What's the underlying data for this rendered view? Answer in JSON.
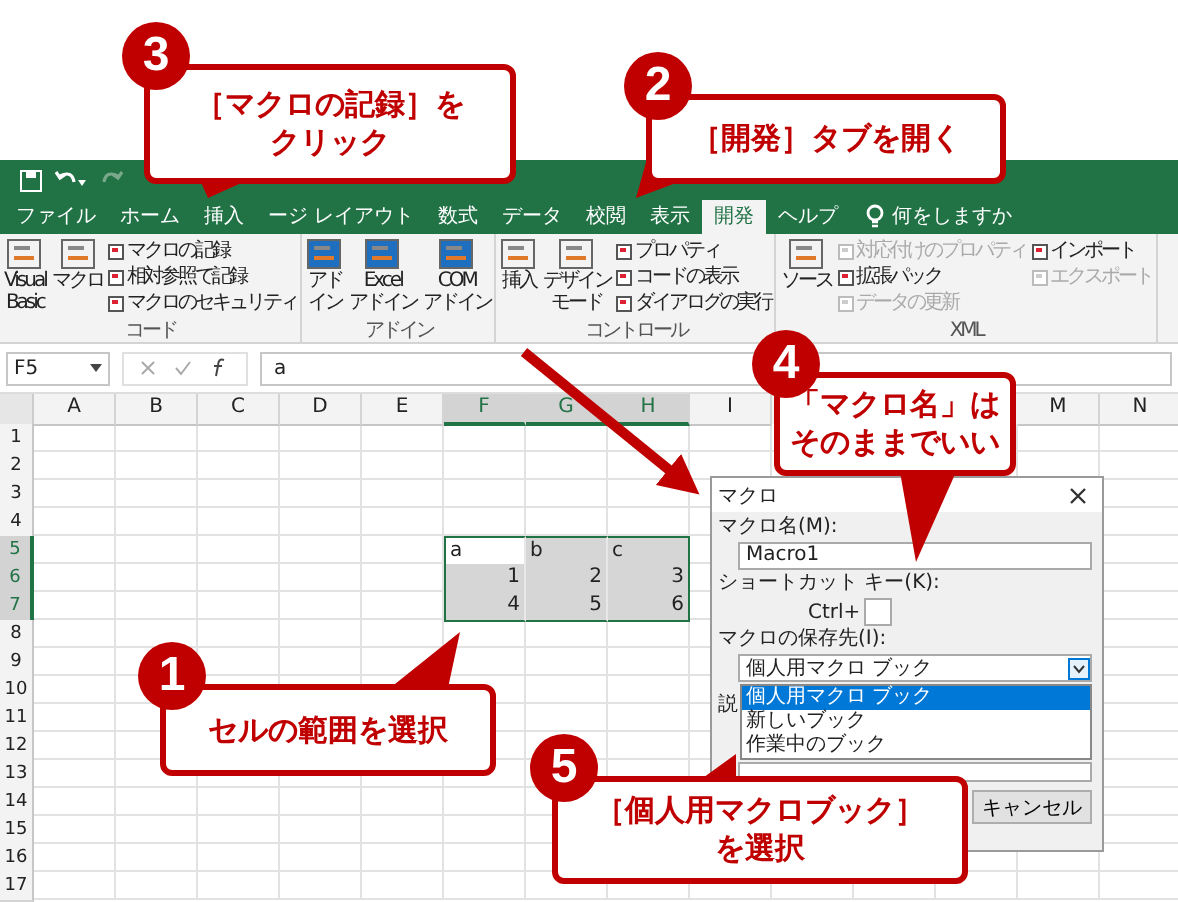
{
  "tabs": [
    {
      "label": "ファイル",
      "selected": false
    },
    {
      "label": "ホーム",
      "selected": false
    },
    {
      "label": "挿入",
      "selected": false
    },
    {
      "label": "ージ レイアウト",
      "selected": false
    },
    {
      "label": "数式",
      "selected": false
    },
    {
      "label": "データ",
      "selected": false
    },
    {
      "label": "校閲",
      "selected": false
    },
    {
      "label": "表示",
      "selected": false
    },
    {
      "label": "開発",
      "selected": true
    },
    {
      "label": "ヘルプ",
      "selected": false
    }
  ],
  "tell_me": "何をしますか",
  "ribbon": {
    "groups": [
      {
        "label": "コード",
        "buttons": [
          {
            "lines": [
              "Visual",
              "Basic"
            ],
            "kind": "large",
            "disabled": false
          },
          {
            "lines": [
              "マクロ"
            ],
            "kind": "large",
            "disabled": false
          },
          {
            "label": "マクロの記録",
            "kind": "small",
            "disabled": false
          },
          {
            "label": "相対参照で記録",
            "kind": "small",
            "disabled": false
          },
          {
            "label": "マクロのセキュリティ",
            "kind": "small",
            "disabled": false
          }
        ]
      },
      {
        "label": "アドイン",
        "buttons": [
          {
            "lines": [
              "アド",
              "イン"
            ],
            "kind": "large",
            "disabled": false
          },
          {
            "lines": [
              "Excel",
              "アドイン"
            ],
            "kind": "large",
            "disabled": false
          },
          {
            "lines": [
              "COM",
              "アドイン"
            ],
            "kind": "large",
            "disabled": false
          }
        ]
      },
      {
        "label": "コントロール",
        "buttons": [
          {
            "lines": [
              "挿入"
            ],
            "kind": "large",
            "disabled": false
          },
          {
            "lines": [
              "デザイン",
              "モード"
            ],
            "kind": "large",
            "disabled": false
          },
          {
            "label": "プロパティ",
            "kind": "small",
            "disabled": false
          },
          {
            "label": "コードの表示",
            "kind": "small",
            "disabled": false
          },
          {
            "label": "ダイアログの実行",
            "kind": "small",
            "disabled": false
          }
        ]
      },
      {
        "label": "XML",
        "buttons": [
          {
            "lines": [
              "ソース"
            ],
            "kind": "large",
            "disabled": false
          },
          {
            "label": "対応付けのプロパティ",
            "kind": "small",
            "disabled": true
          },
          {
            "label": "拡張パック",
            "kind": "small",
            "disabled": false
          },
          {
            "label": "データの更新",
            "kind": "small",
            "disabled": true
          },
          {
            "label": "インポート",
            "kind": "small",
            "disabled": false
          },
          {
            "label": "エクスポート",
            "kind": "small",
            "disabled": true
          }
        ]
      }
    ]
  },
  "formula_bar": {
    "name_box": "F5",
    "value": "a"
  },
  "grid": {
    "columns": [
      {
        "label": "A",
        "selected": false
      },
      {
        "label": "B",
        "selected": false
      },
      {
        "label": "C",
        "selected": false
      },
      {
        "label": "D",
        "selected": false
      },
      {
        "label": "E",
        "selected": false
      },
      {
        "label": "F",
        "selected": true
      },
      {
        "label": "G",
        "selected": true
      },
      {
        "label": "H",
        "selected": true
      },
      {
        "label": "I",
        "selected": false
      },
      {},
      {},
      {},
      {
        "label": "M",
        "selected": false
      },
      {
        "label": "N",
        "selected": false
      }
    ],
    "rows": [
      {
        "label": "1",
        "selected": false
      },
      {
        "label": "2",
        "selected": false
      },
      {
        "label": "3",
        "selected": false
      },
      {
        "label": "4",
        "selected": false
      },
      {
        "label": "5",
        "selected": true
      },
      {
        "label": "6",
        "selected": true
      },
      {
        "label": "7",
        "selected": true
      },
      {
        "label": "8",
        "selected": false
      },
      {
        "label": "9",
        "selected": false
      },
      {
        "label": "10",
        "selected": false
      },
      {
        "label": "11",
        "selected": false
      },
      {
        "label": "12",
        "selected": false
      },
      {
        "label": "13",
        "selected": false
      },
      {
        "label": "14",
        "selected": false
      },
      {
        "label": "15",
        "selected": false
      },
      {
        "label": "16",
        "selected": false
      },
      {
        "label": "17",
        "selected": false
      }
    ],
    "selection": [
      [
        {
          "text": "a",
          "kind": "text"
        },
        {
          "text": "b",
          "kind": "text"
        },
        {
          "text": "c",
          "kind": "text"
        }
      ],
      [
        {
          "text": "1",
          "kind": "number"
        },
        {
          "text": "2",
          "kind": "number"
        },
        {
          "text": "3",
          "kind": "number"
        }
      ],
      [
        {
          "text": "4",
          "kind": "number"
        },
        {
          "text": "5",
          "kind": "number"
        },
        {
          "text": "6",
          "kind": "number"
        }
      ]
    ]
  },
  "dialog": {
    "title": "マクロ",
    "macro_name_label": "マクロ名(M):",
    "macro_name": "Macro1",
    "shortcut_label": "ショートカット キー(K):",
    "ctrl_label": "Ctrl+",
    "store_label": "マクロの保存先(I):",
    "store_value": "個人用マクロ ブック",
    "store_options": [
      {
        "label": "個人用マクロ ブック",
        "selected": true
      },
      {
        "label": "新しいブック",
        "selected": false
      },
      {
        "label": "作業中のブック",
        "selected": false
      }
    ],
    "description_label": "説",
    "cancel_button": "キャンセル"
  },
  "callouts": [
    {
      "number": "3",
      "lines": [
        "［マクロの記録］を",
        "クリック"
      ]
    },
    {
      "number": "2",
      "lines": [
        "［開発］タブを開く"
      ]
    },
    {
      "number": "4",
      "lines": [
        "「マクロ名」は",
        "そのままでいい"
      ]
    },
    {
      "number": "1",
      "lines": [
        "セルの範囲を選択"
      ]
    },
    {
      "number": "5",
      "lines": [
        "［個人用マクロブック］",
        "を選択"
      ]
    }
  ]
}
